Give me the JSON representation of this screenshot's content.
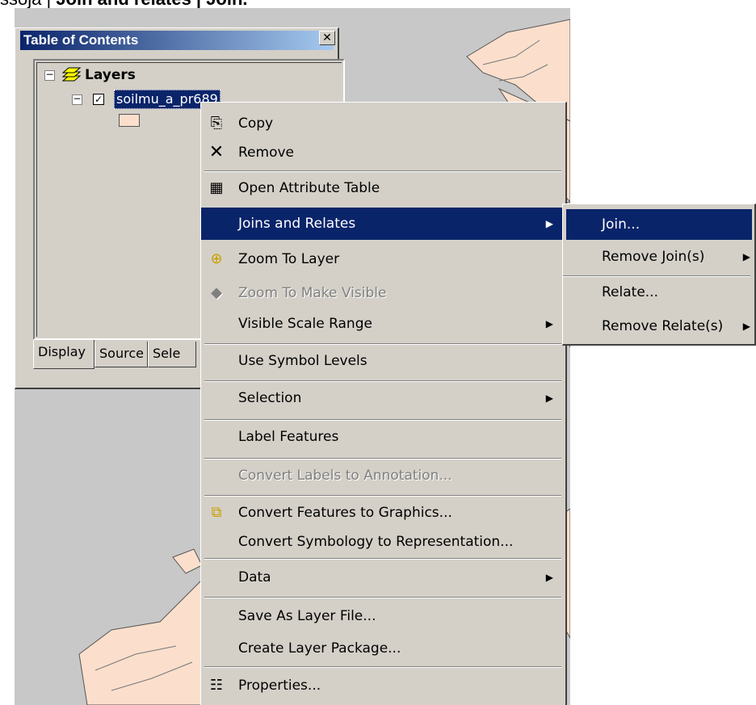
{
  "caption": {
    "prefix": "ssoja | ",
    "bold": "Join and relates | Join."
  },
  "toc": {
    "title": "Table of Contents",
    "close_glyph": "✕",
    "root_label": "Layers",
    "layer_name": "soilmu_a_pr689",
    "layer_checked": true,
    "swatch_color": "#fbdfcc",
    "tabs": [
      "Display",
      "Source",
      "Sele"
    ]
  },
  "menu": {
    "items": [
      {
        "label": "Copy",
        "icon": "copy-icon",
        "glyph": "⎘"
      },
      {
        "label": "Remove",
        "icon": "remove-icon",
        "glyph": "✕"
      },
      {
        "label": "Open Attribute Table",
        "icon": "table-icon",
        "glyph": "▦"
      },
      {
        "label": "Joins and Relates",
        "highlighted": true
      },
      {
        "label": "Zoom To Layer",
        "icon": "zoom-to-layer-icon",
        "glyph": "⊕"
      },
      {
        "label": "Zoom To Make Visible",
        "icon": "zoom-visible-icon",
        "glyph": "◆",
        "disabled": true
      },
      {
        "label": "Visible Scale Range"
      },
      {
        "label": "Use Symbol Levels"
      },
      {
        "label": "Selection"
      },
      {
        "label": "Label Features"
      },
      {
        "label": "Convert Labels to Annotation...",
        "disabled": true
      },
      {
        "label": "Convert Features to Graphics...",
        "icon": "convert-graphics-icon",
        "glyph": "⧉"
      },
      {
        "label": "Convert Symbology to Representation..."
      },
      {
        "label": "Data"
      },
      {
        "label": "Save As Layer File..."
      },
      {
        "label": "Create Layer Package..."
      },
      {
        "label": "Properties...",
        "icon": "properties-icon",
        "glyph": "☷"
      }
    ]
  },
  "submenu": {
    "items": [
      {
        "label": "Join...",
        "highlighted": true
      },
      {
        "label": "Remove Join(s)"
      },
      {
        "label": "Relate..."
      },
      {
        "label": "Remove Relate(s)"
      }
    ]
  },
  "colors": {
    "highlight": "#0a246a",
    "face": "#d4d0c8",
    "map_bg": "#c8c8c8",
    "polygon_fill": "#fbdfcc"
  }
}
